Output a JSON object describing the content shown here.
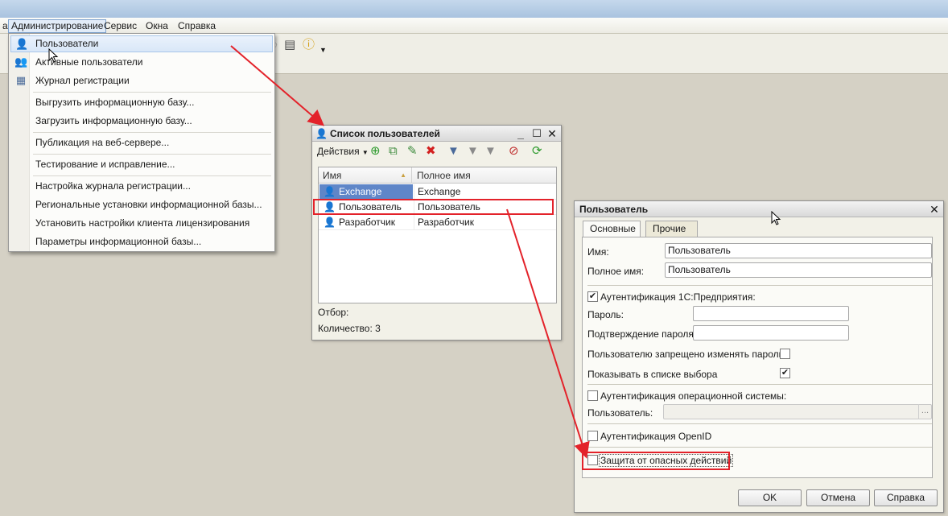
{
  "menubar": {
    "cut_item": "а",
    "items": [
      "Администрирование",
      "Сервис",
      "Окна",
      "Справка"
    ]
  },
  "admin_menu": {
    "items": [
      "Пользователи",
      "Активные пользователи",
      "Журнал регистрации",
      "Выгрузить информационную базу...",
      "Загрузить информационную базу...",
      "Публикация на веб-сервере...",
      "Тестирование и исправление...",
      "Настройка журнала регистрации...",
      "Региональные установки информационной базы...",
      "Установить настройки клиента лицензирования",
      "Параметры информационной базы..."
    ]
  },
  "user_list": {
    "title": "Список пользователей",
    "actions_label": "Действия",
    "columns": [
      "Имя",
      "Полное имя"
    ],
    "rows": [
      {
        "name": "Exchange",
        "full_name": "Exchange"
      },
      {
        "name": "Пользователь",
        "full_name": "Пользователь"
      },
      {
        "name": "Разработчик",
        "full_name": "Разработчик"
      }
    ],
    "filter_label": "Отбор:",
    "count_label": "Количество: 3"
  },
  "user_form": {
    "title": "Пользователь",
    "tabs": [
      "Основные",
      "Прочие"
    ],
    "name_label": "Имя:",
    "name_value": "Пользователь",
    "full_name_label": "Полное имя:",
    "full_name_value": "Пользователь",
    "auth_1c_label": "Аутентификация 1С:Предприятия:",
    "password_label": "Пароль:",
    "password_confirm_label": "Подтверждение пароля:",
    "deny_change_label": "Пользователю запрещено изменять пароль",
    "show_in_list_label": "Показывать в списке выбора",
    "auth_os_label": "Аутентификация операционной системы:",
    "os_user_label": "Пользователь:",
    "ellipsis": "...",
    "auth_openid_label": "Аутентификация OpenID",
    "protection_label": "Защита от опасных действий",
    "ok_label": "OK",
    "cancel_label": "Отмена",
    "help_label": "Справка"
  },
  "colors": {
    "highlight": "#e3222a",
    "selection": "#5f86c8"
  }
}
